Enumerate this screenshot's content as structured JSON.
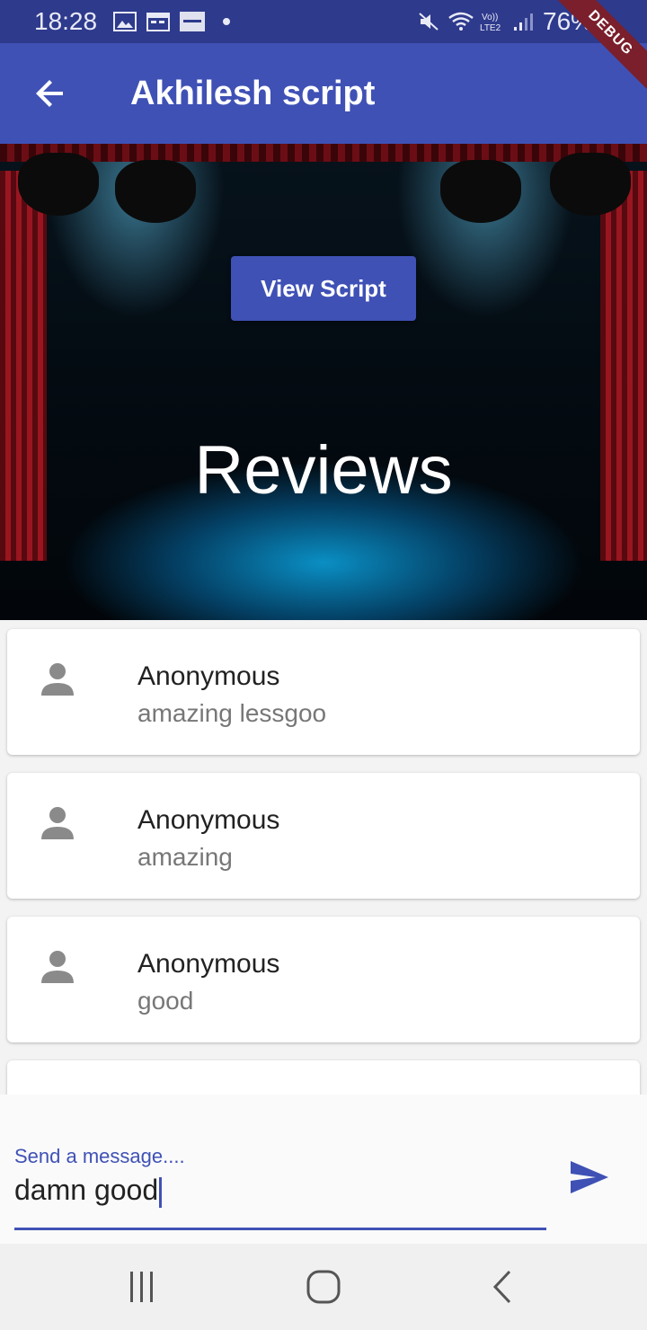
{
  "status_bar": {
    "time": "18:28",
    "battery": "76%"
  },
  "app_bar": {
    "title": "Akhilesh script",
    "debug_label": "DEBUG"
  },
  "hero": {
    "button_label": "View Script",
    "heading": "Reviews"
  },
  "reviews": [
    {
      "name": "Anonymous",
      "text": "amazing lessgoo"
    },
    {
      "name": "Anonymous",
      "text": "amazing"
    },
    {
      "name": "Anonymous",
      "text": "good"
    },
    {
      "name": "",
      "text": ""
    }
  ],
  "message_input": {
    "label": "Send a message....",
    "value": "damn good"
  },
  "colors": {
    "primary": "#3f51b5",
    "status_bar": "#2e3a8c"
  },
  "icons": [
    "back-arrow-icon",
    "send-icon",
    "person-icon",
    "recents-icon",
    "home-icon",
    "nav-back-icon"
  ]
}
